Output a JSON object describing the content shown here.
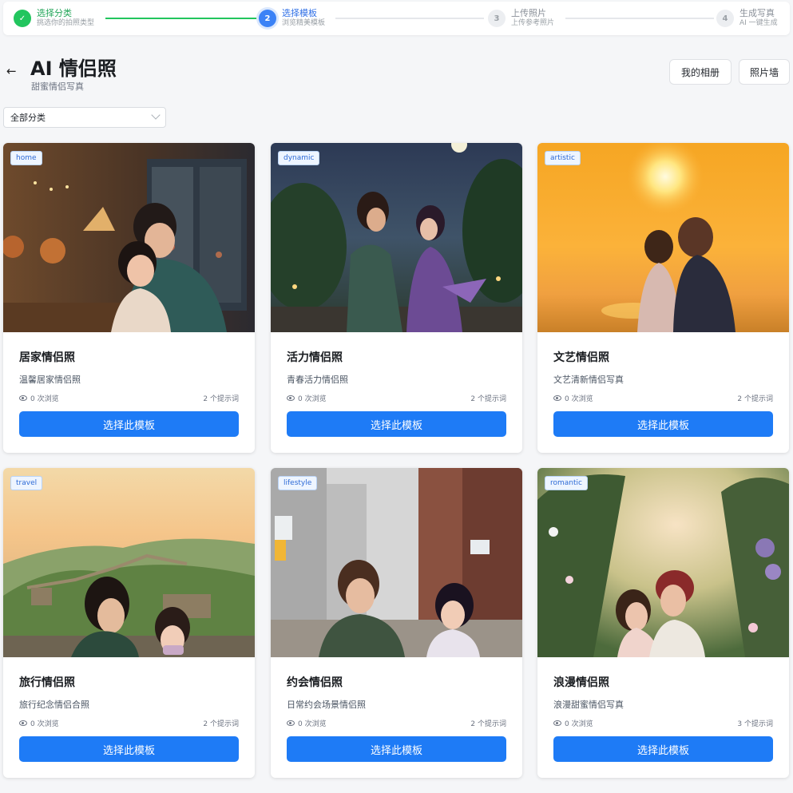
{
  "stepper": {
    "steps": [
      {
        "num": "✓",
        "title": "选择分类",
        "sub": "挑选你的拍照类型"
      },
      {
        "num": "2",
        "title": "选择模板",
        "sub": "浏览精美模板"
      },
      {
        "num": "3",
        "title": "上传照片",
        "sub": "上传参考照片"
      },
      {
        "num": "4",
        "title": "生成写真",
        "sub": "AI 一键生成"
      }
    ]
  },
  "header": {
    "back_icon": "←",
    "title": "AI 情侣照",
    "subtitle": "甜蜜情侣写真",
    "album_button": "我的相册",
    "wall_button": "照片墙"
  },
  "filter": {
    "selected": "全部分类"
  },
  "colors": {
    "accent": "#1e7bf6",
    "done": "#22c55e",
    "tag_bg": "#eef5ff"
  },
  "cards": [
    {
      "tag": "home",
      "title": "居家情侣照",
      "desc": "温馨居家情侣照",
      "views": "0 次浏览",
      "prompts": "2 个提示词",
      "button": "选择此模板"
    },
    {
      "tag": "dynamic",
      "title": "活力情侣照",
      "desc": "青春活力情侣照",
      "views": "0 次浏览",
      "prompts": "2 个提示词",
      "button": "选择此模板"
    },
    {
      "tag": "artistic",
      "title": "文艺情侣照",
      "desc": "文艺清新情侣写真",
      "views": "0 次浏览",
      "prompts": "2 个提示词",
      "button": "选择此模板"
    },
    {
      "tag": "travel",
      "title": "旅行情侣照",
      "desc": "旅行纪念情侣合照",
      "views": "0 次浏览",
      "prompts": "2 个提示词",
      "button": "选择此模板"
    },
    {
      "tag": "lifestyle",
      "title": "约会情侣照",
      "desc": "日常约会场景情侣照",
      "views": "0 次浏览",
      "prompts": "2 个提示词",
      "button": "选择此模板"
    },
    {
      "tag": "romantic",
      "title": "浪漫情侣照",
      "desc": "浪漫甜蜜情侣写真",
      "views": "0 次浏览",
      "prompts": "3 个提示词",
      "button": "选择此模板"
    }
  ]
}
